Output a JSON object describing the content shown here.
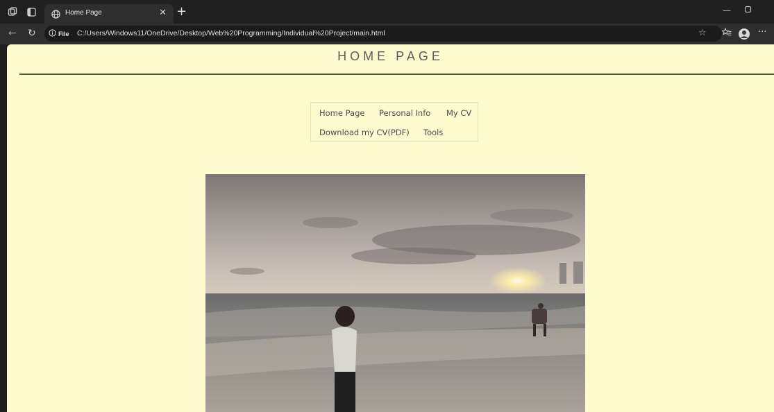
{
  "browser": {
    "tab": {
      "title": "Home Page"
    },
    "address": {
      "protocol_label": "File",
      "url": "C:/Users/Windows11/OneDrive/Desktop/Web%20Programming/Individual%20Project/main.html"
    },
    "icons": [
      "workspaces-icon",
      "tab-actions-icon",
      "globe-icon",
      "close-icon",
      "plus-icon",
      "back-icon",
      "refresh-icon",
      "info-icon",
      "star-icon",
      "favorites-icon",
      "profile-icon",
      "more-icon",
      "minimize-icon",
      "maximize-icon"
    ]
  },
  "page": {
    "title": "HOME PAGE",
    "nav": {
      "items": [
        {
          "label": "Home Page"
        },
        {
          "label": "Personal Info"
        },
        {
          "label": "My CV"
        },
        {
          "label": "Download my CV(PDF)"
        },
        {
          "label": "Tools"
        }
      ]
    },
    "photo": {
      "subject": "beach-sunset-photo"
    }
  },
  "colors": {
    "page_background": "#fefbcf",
    "title_text": "#5b5b5b",
    "rule": "#4b5b3a",
    "nav_border": "#d8e7c0",
    "chrome_dark": "#202020"
  }
}
